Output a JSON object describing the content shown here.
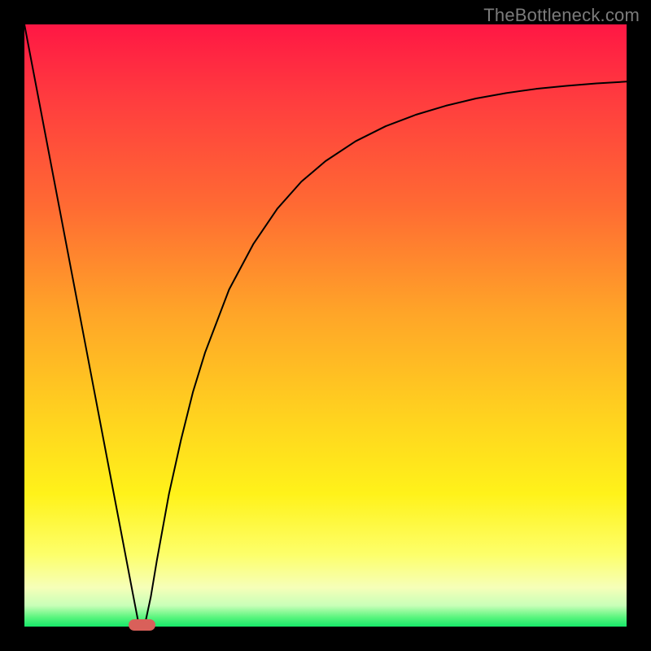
{
  "watermark": "TheBottleneck.com",
  "chart_data": {
    "type": "line",
    "title": "",
    "xlabel": "",
    "ylabel": "",
    "xlim": [
      0,
      100
    ],
    "ylim": [
      0,
      100
    ],
    "gradient": [
      {
        "offset": 0.0,
        "color": "#ff1744"
      },
      {
        "offset": 0.12,
        "color": "#ff3b3f"
      },
      {
        "offset": 0.3,
        "color": "#ff6a33"
      },
      {
        "offset": 0.48,
        "color": "#ffa528"
      },
      {
        "offset": 0.65,
        "color": "#ffd21f"
      },
      {
        "offset": 0.78,
        "color": "#fff21a"
      },
      {
        "offset": 0.88,
        "color": "#fdff6a"
      },
      {
        "offset": 0.935,
        "color": "#f6ffb8"
      },
      {
        "offset": 0.965,
        "color": "#c9ffb8"
      },
      {
        "offset": 0.985,
        "color": "#57f57d"
      },
      {
        "offset": 1.0,
        "color": "#17e86a"
      }
    ],
    "series": [
      {
        "name": "bottleneck-curve",
        "x": [
          0,
          2,
          4,
          6,
          8,
          10,
          12,
          14,
          16,
          18,
          19,
          20,
          21,
          22,
          24,
          26,
          28,
          30,
          34,
          38,
          42,
          46,
          50,
          55,
          60,
          65,
          70,
          75,
          80,
          85,
          90,
          95,
          100
        ],
        "y": [
          100,
          89.5,
          79,
          68.5,
          58,
          47.5,
          37,
          26.5,
          16,
          5.5,
          0.3,
          0.3,
          5,
          11,
          22,
          31,
          39,
          45.5,
          56,
          63.5,
          69.4,
          73.9,
          77.3,
          80.6,
          83.1,
          85.0,
          86.5,
          87.7,
          88.6,
          89.3,
          89.8,
          90.2,
          90.5
        ]
      }
    ],
    "optimal_marker": {
      "x_center": 19.5,
      "width_pct": 4.5
    }
  }
}
